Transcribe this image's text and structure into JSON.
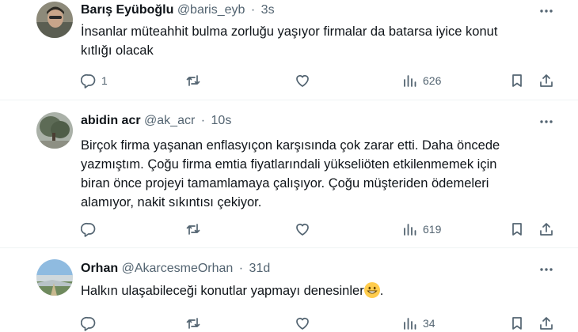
{
  "tweets": [
    {
      "name": "Barış Eyüboğlu",
      "handle": "@baris_eyb",
      "separator": "·",
      "time": "3s",
      "text_lines": [
        "İnsanlar müteahhit bulma zorluğu yaşıyor firmalar da batarsa iyice konut",
        "kıtlığı olacak"
      ],
      "replies": "1",
      "reposts": "",
      "likes": "",
      "views": "626"
    },
    {
      "name": "abidin acr",
      "handle": "@ak_acr",
      "separator": "·",
      "time": "10s",
      "text_lines": [
        "Birçok firma yaşanan enflasyıçon karşısında çok zarar etti. Daha öncede",
        "yazmıştım. Çoğu firma emtia fiyatlarındali yükseliöten etkilenmemek için",
        "biran önce projeyi tamamlamaya çalışıyor. Çoğu müşteriden ödemeleri",
        "alamıyor, nakit sıkıntısı çekiyor."
      ],
      "replies": "",
      "reposts": "",
      "likes": "",
      "views": "619"
    },
    {
      "name": "Orhan",
      "handle": "@AkarcesmeOrhan",
      "separator": "·",
      "time": "31d",
      "text_lines": [
        "Halkın ulaşabileceği konutlar yapmayı denesinler"
      ],
      "text_suffix": ".",
      "emoji": "grinning-face",
      "replies": "",
      "reposts": "",
      "likes": "",
      "views": "34"
    }
  ],
  "icons": {
    "reply": "reply-icon",
    "repost": "repost-icon",
    "like": "like-icon",
    "views": "views-icon",
    "bookmark": "bookmark-icon",
    "share": "share-icon",
    "more": "more-icon"
  },
  "colors": {
    "text": "#0f1419",
    "secondary": "#536471",
    "divider": "#eff3f4",
    "emoji": "#ffcc4d"
  }
}
